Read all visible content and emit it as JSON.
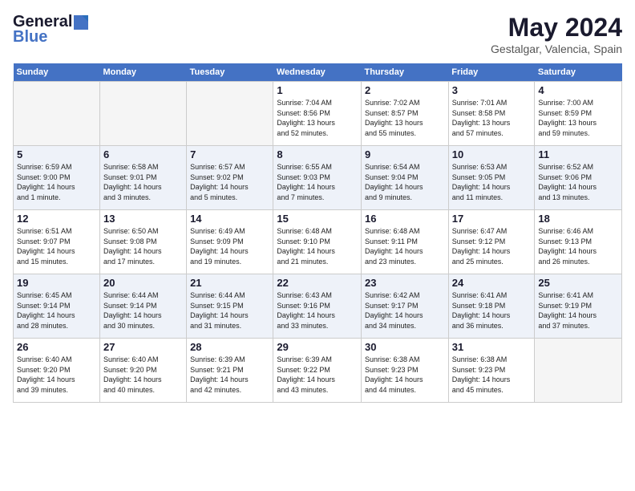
{
  "header": {
    "logo_line1": "General",
    "logo_line2": "Blue",
    "month": "May 2024",
    "location": "Gestalgar, Valencia, Spain"
  },
  "weekdays": [
    "Sunday",
    "Monday",
    "Tuesday",
    "Wednesday",
    "Thursday",
    "Friday",
    "Saturday"
  ],
  "weeks": [
    [
      {
        "day": "",
        "info": ""
      },
      {
        "day": "",
        "info": ""
      },
      {
        "day": "",
        "info": ""
      },
      {
        "day": "1",
        "info": "Sunrise: 7:04 AM\nSunset: 8:56 PM\nDaylight: 13 hours\nand 52 minutes."
      },
      {
        "day": "2",
        "info": "Sunrise: 7:02 AM\nSunset: 8:57 PM\nDaylight: 13 hours\nand 55 minutes."
      },
      {
        "day": "3",
        "info": "Sunrise: 7:01 AM\nSunset: 8:58 PM\nDaylight: 13 hours\nand 57 minutes."
      },
      {
        "day": "4",
        "info": "Sunrise: 7:00 AM\nSunset: 8:59 PM\nDaylight: 13 hours\nand 59 minutes."
      }
    ],
    [
      {
        "day": "5",
        "info": "Sunrise: 6:59 AM\nSunset: 9:00 PM\nDaylight: 14 hours\nand 1 minute."
      },
      {
        "day": "6",
        "info": "Sunrise: 6:58 AM\nSunset: 9:01 PM\nDaylight: 14 hours\nand 3 minutes."
      },
      {
        "day": "7",
        "info": "Sunrise: 6:57 AM\nSunset: 9:02 PM\nDaylight: 14 hours\nand 5 minutes."
      },
      {
        "day": "8",
        "info": "Sunrise: 6:55 AM\nSunset: 9:03 PM\nDaylight: 14 hours\nand 7 minutes."
      },
      {
        "day": "9",
        "info": "Sunrise: 6:54 AM\nSunset: 9:04 PM\nDaylight: 14 hours\nand 9 minutes."
      },
      {
        "day": "10",
        "info": "Sunrise: 6:53 AM\nSunset: 9:05 PM\nDaylight: 14 hours\nand 11 minutes."
      },
      {
        "day": "11",
        "info": "Sunrise: 6:52 AM\nSunset: 9:06 PM\nDaylight: 14 hours\nand 13 minutes."
      }
    ],
    [
      {
        "day": "12",
        "info": "Sunrise: 6:51 AM\nSunset: 9:07 PM\nDaylight: 14 hours\nand 15 minutes."
      },
      {
        "day": "13",
        "info": "Sunrise: 6:50 AM\nSunset: 9:08 PM\nDaylight: 14 hours\nand 17 minutes."
      },
      {
        "day": "14",
        "info": "Sunrise: 6:49 AM\nSunset: 9:09 PM\nDaylight: 14 hours\nand 19 minutes."
      },
      {
        "day": "15",
        "info": "Sunrise: 6:48 AM\nSunset: 9:10 PM\nDaylight: 14 hours\nand 21 minutes."
      },
      {
        "day": "16",
        "info": "Sunrise: 6:48 AM\nSunset: 9:11 PM\nDaylight: 14 hours\nand 23 minutes."
      },
      {
        "day": "17",
        "info": "Sunrise: 6:47 AM\nSunset: 9:12 PM\nDaylight: 14 hours\nand 25 minutes."
      },
      {
        "day": "18",
        "info": "Sunrise: 6:46 AM\nSunset: 9:13 PM\nDaylight: 14 hours\nand 26 minutes."
      }
    ],
    [
      {
        "day": "19",
        "info": "Sunrise: 6:45 AM\nSunset: 9:14 PM\nDaylight: 14 hours\nand 28 minutes."
      },
      {
        "day": "20",
        "info": "Sunrise: 6:44 AM\nSunset: 9:14 PM\nDaylight: 14 hours\nand 30 minutes."
      },
      {
        "day": "21",
        "info": "Sunrise: 6:44 AM\nSunset: 9:15 PM\nDaylight: 14 hours\nand 31 minutes."
      },
      {
        "day": "22",
        "info": "Sunrise: 6:43 AM\nSunset: 9:16 PM\nDaylight: 14 hours\nand 33 minutes."
      },
      {
        "day": "23",
        "info": "Sunrise: 6:42 AM\nSunset: 9:17 PM\nDaylight: 14 hours\nand 34 minutes."
      },
      {
        "day": "24",
        "info": "Sunrise: 6:41 AM\nSunset: 9:18 PM\nDaylight: 14 hours\nand 36 minutes."
      },
      {
        "day": "25",
        "info": "Sunrise: 6:41 AM\nSunset: 9:19 PM\nDaylight: 14 hours\nand 37 minutes."
      }
    ],
    [
      {
        "day": "26",
        "info": "Sunrise: 6:40 AM\nSunset: 9:20 PM\nDaylight: 14 hours\nand 39 minutes."
      },
      {
        "day": "27",
        "info": "Sunrise: 6:40 AM\nSunset: 9:20 PM\nDaylight: 14 hours\nand 40 minutes."
      },
      {
        "day": "28",
        "info": "Sunrise: 6:39 AM\nSunset: 9:21 PM\nDaylight: 14 hours\nand 42 minutes."
      },
      {
        "day": "29",
        "info": "Sunrise: 6:39 AM\nSunset: 9:22 PM\nDaylight: 14 hours\nand 43 minutes."
      },
      {
        "day": "30",
        "info": "Sunrise: 6:38 AM\nSunset: 9:23 PM\nDaylight: 14 hours\nand 44 minutes."
      },
      {
        "day": "31",
        "info": "Sunrise: 6:38 AM\nSunset: 9:23 PM\nDaylight: 14 hours\nand 45 minutes."
      },
      {
        "day": "",
        "info": ""
      }
    ]
  ]
}
